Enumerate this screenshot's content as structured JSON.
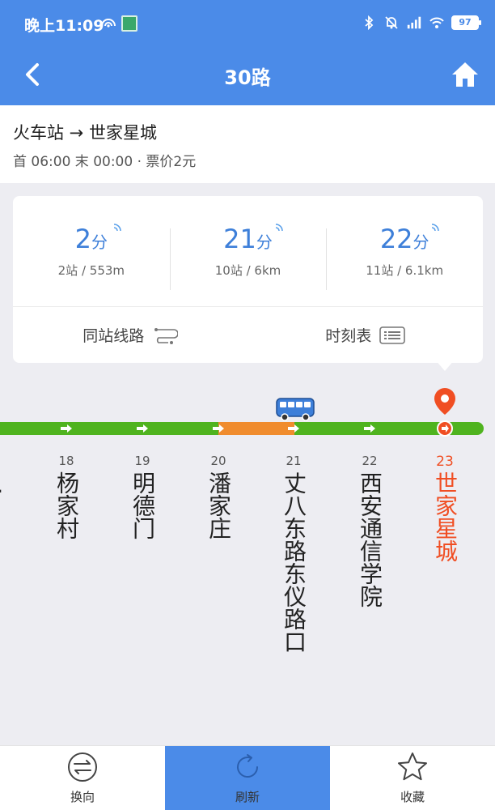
{
  "status_bar": {
    "time": "晚上11:09",
    "battery": "97"
  },
  "nav": {
    "title": "30路"
  },
  "route": {
    "direction": "火车站 → 世家星城",
    "schedule": "首 06:00 末 00:00 · 票价2元"
  },
  "arrivals": [
    {
      "minutes": "2",
      "unit": "分",
      "distance": "2站 / 553m"
    },
    {
      "minutes": "21",
      "unit": "分",
      "distance": "10站 / 6km"
    },
    {
      "minutes": "22",
      "unit": "分",
      "distance": "11站 / 6.1km"
    }
  ],
  "actions": {
    "same_station_lines": "同站线路",
    "timetable": "时刻表"
  },
  "stations": [
    {
      "number": "18",
      "name": "杨家村"
    },
    {
      "number": "19",
      "name": "明德门"
    },
    {
      "number": "20",
      "name": "潘家庄"
    },
    {
      "number": "21",
      "name": "丈八东路东仪路口"
    },
    {
      "number": "22",
      "name": "西安通信学院"
    },
    {
      "number": "23",
      "name": "世家星城"
    }
  ],
  "partial_station_name": "…",
  "bottom_bar": {
    "reverse": "换向",
    "refresh": "刷新",
    "favorite": "收藏"
  },
  "colors": {
    "primary": "#4b8be8",
    "line_green": "#4fb31f",
    "line_orange": "#f08c2e",
    "destination": "#f04e23"
  }
}
